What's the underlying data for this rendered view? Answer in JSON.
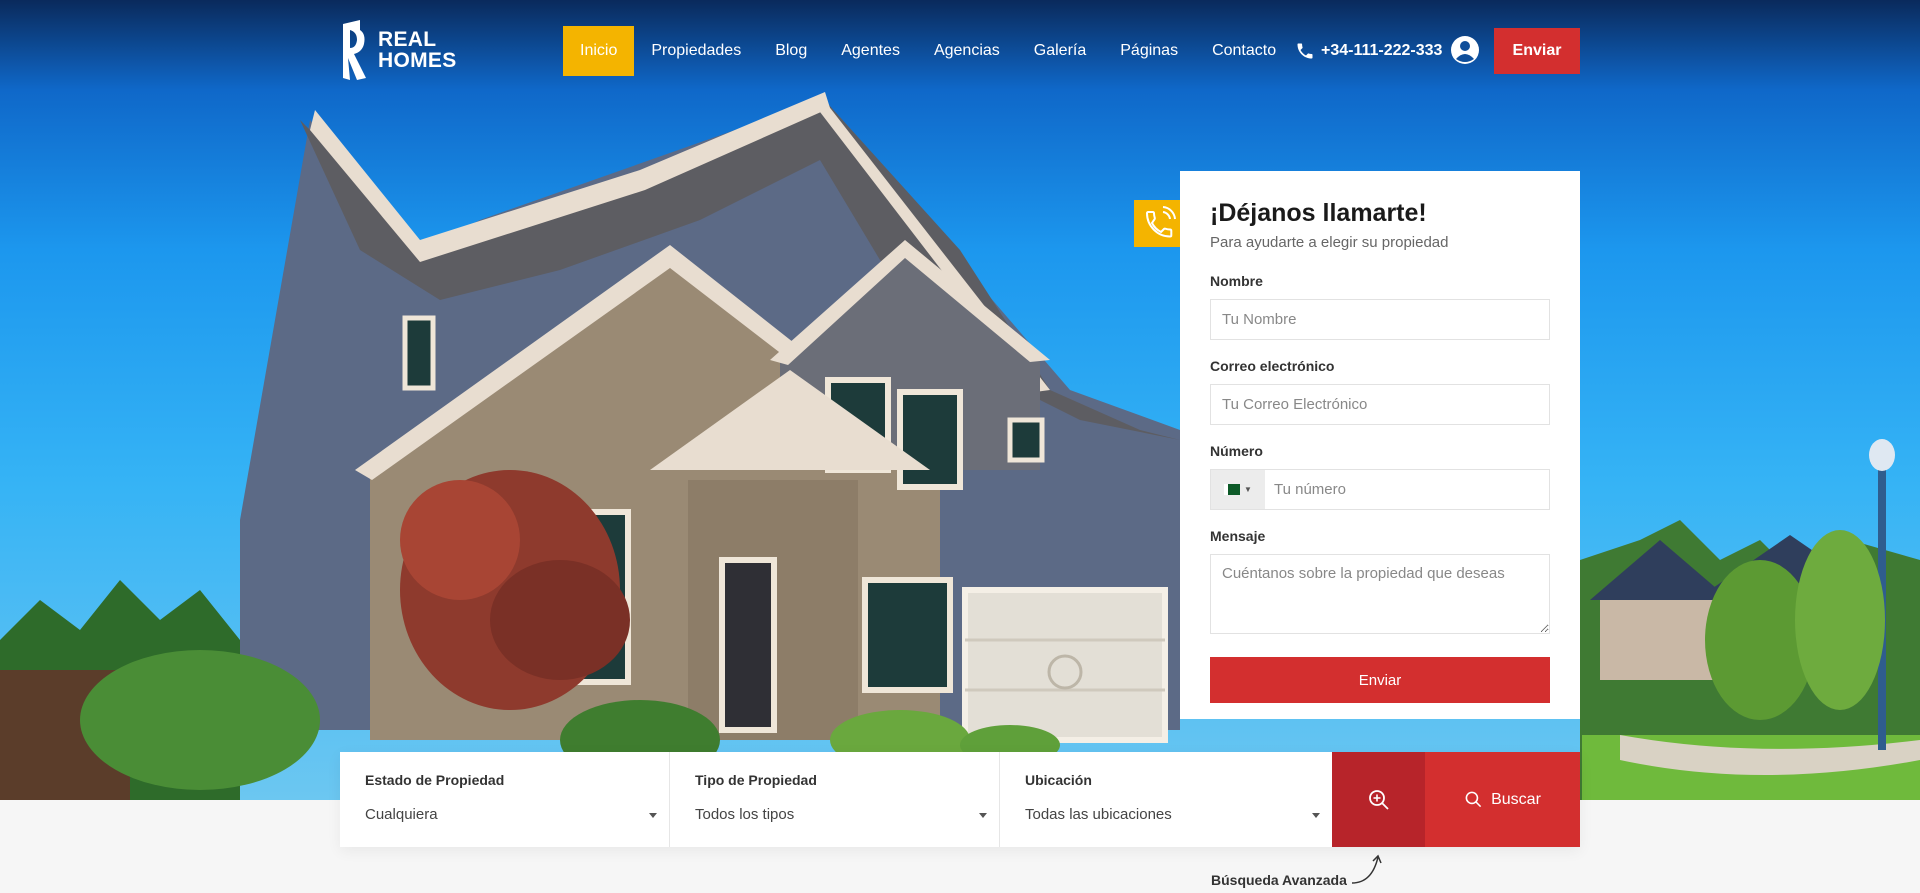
{
  "brand": {
    "line1": "REAL",
    "line2": "HOMES"
  },
  "nav": {
    "items": [
      {
        "label": "Inicio",
        "active": true
      },
      {
        "label": "Propiedades"
      },
      {
        "label": "Blog"
      },
      {
        "label": "Agentes"
      },
      {
        "label": "Agencias"
      },
      {
        "label": "Galería"
      },
      {
        "label": "Páginas"
      },
      {
        "label": "Contacto"
      }
    ]
  },
  "header": {
    "phone": "+34-111-222-333",
    "send_label": "Enviar",
    "icons": {
      "phone": "phone-icon",
      "user": "user-circle-icon"
    }
  },
  "callback_form": {
    "title": "¡Déjanos llamarte!",
    "subtitle": "Para ayudarte a elegir su propiedad",
    "name_label": "Nombre",
    "name_placeholder": "Tu Nombre",
    "email_label": "Correo electrónico",
    "email_placeholder": "Tu Correo Electrónico",
    "number_label": "Número",
    "number_placeholder": "Tu número",
    "message_label": "Mensaje",
    "message_placeholder": "Cuéntanos sobre la propiedad que deseas",
    "submit_label": "Enviar",
    "badge_icon": "phone-call-icon"
  },
  "search": {
    "fields": [
      {
        "label": "Estado de Propiedad",
        "value": "Cualquiera"
      },
      {
        "label": "Tipo de Propiedad",
        "value": "Todos los tipos"
      },
      {
        "label": "Ubicación",
        "value": "Todas las ubicaciones"
      }
    ],
    "search_label": "Buscar",
    "advanced_note": "Búsqueda Avanzada"
  },
  "colors": {
    "accent": "#f4b400",
    "primary_red": "#d32f2f",
    "dark_red": "#b7242a"
  }
}
